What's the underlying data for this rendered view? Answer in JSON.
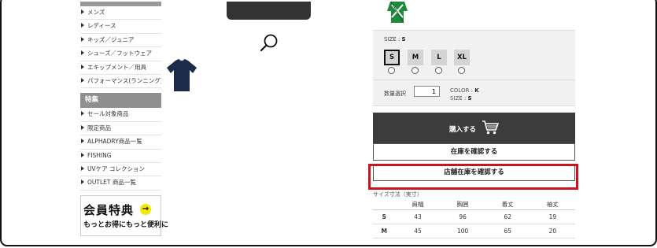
{
  "sidebar": {
    "items": [
      {
        "label": "メンズ"
      },
      {
        "label": "レディース"
      },
      {
        "label": "キッズ／ジュニア"
      },
      {
        "label": "シューズ／フットウェア"
      },
      {
        "label": "エキップメント／用具"
      },
      {
        "label": "パフォーマンス(ランニング)"
      }
    ],
    "feature_header": "特集",
    "feature_items": [
      {
        "label": "セール対象商品"
      },
      {
        "label": "限定商品"
      },
      {
        "label": "ALPHADRY商品一覧"
      },
      {
        "label": "FISHING"
      },
      {
        "label": "UVケア コレクション"
      },
      {
        "label": "OUTLET 商品一覧"
      }
    ],
    "banner": {
      "main": "会員特典",
      "arrow": "→",
      "sub": "もっとお得にもっと便利に"
    }
  },
  "colors": {
    "accent_red": "#c8141f",
    "cart_button_bg": "#3c3c3c",
    "swatch_green": "#1e8a3c"
  },
  "product": {
    "size_label": "SIZE : ",
    "size_value": "S",
    "sizes": [
      "S",
      "M",
      "L",
      "XL"
    ],
    "selected_size": "S",
    "qty_label": "数量選択",
    "qty_value": "1",
    "color_label": "COLOR : ",
    "color_value": "K",
    "size_info_label": "SIZE : ",
    "size_info_value": "S"
  },
  "buttons": {
    "cart": "購入する",
    "check_stock": "在庫を確認する",
    "check_store_stock": "店舗在庫を確認する"
  },
  "size_table": {
    "title": "サイズ寸法（実寸）",
    "headers": [
      "",
      "肩幅",
      "胸囲",
      "着丈",
      "袖丈"
    ],
    "rows": [
      [
        "S",
        "43",
        "96",
        "62",
        "19"
      ],
      [
        "M",
        "45",
        "100",
        "65",
        "20"
      ]
    ]
  },
  "icons": {
    "zoom": "magnifier-icon",
    "cart": "shopping-cart-icon",
    "list_marker": "triangle-right-icon"
  }
}
